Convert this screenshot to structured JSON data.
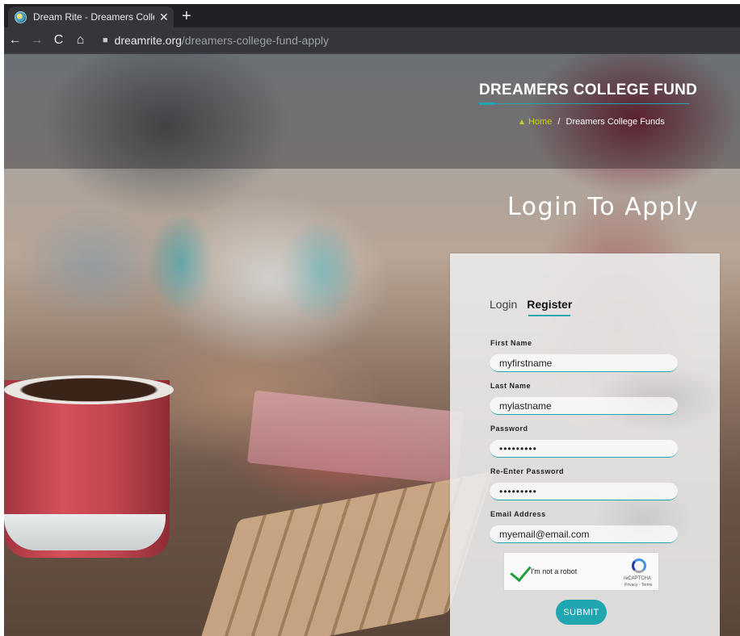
{
  "browser": {
    "tab_title": "Dream Rite - Dreamers College F",
    "tab_close": "✕",
    "new_tab": "+",
    "back": "←",
    "forward": "→",
    "reload": "C",
    "home": "⌂",
    "url_domain": "dreamrite.org",
    "url_path": "/dreamers-college-fund-apply"
  },
  "hero": {
    "title": "DREAMERS COLLEGE FUND",
    "breadcrumb_home": "Home",
    "breadcrumb_separator": "/",
    "breadcrumb_current": "Dreamers College Funds"
  },
  "main": {
    "heading": "Login To Apply"
  },
  "form": {
    "tabs": [
      "Login",
      "Register"
    ],
    "active_tab": "Register",
    "fields": [
      {
        "label": "First Name",
        "value": "myfirstname"
      },
      {
        "label": "Last Name",
        "value": "mylastname"
      },
      {
        "label": "Password",
        "value": "•••••••••"
      },
      {
        "label": "Re-Enter Password",
        "value": "•••••••••"
      },
      {
        "label": "Email Address",
        "value": "myemail@email.com"
      }
    ],
    "captcha": {
      "label": "I'm not a robot",
      "brand": "reCAPTCHA",
      "terms": "Privacy - Terms",
      "checked": true
    },
    "submit_label": "SUBMIT"
  },
  "colors": {
    "accent": "#1fa6b0",
    "breadcrumb_home": "#c9d21f",
    "browser_dark": "#202124"
  },
  "icons": {
    "favicon": "dreamrite-favicon",
    "lock": "lock-icon",
    "home_crumb": "home-icon",
    "captcha_check": "checkmark-icon",
    "captcha_logo": "recaptcha-logo-icon"
  }
}
